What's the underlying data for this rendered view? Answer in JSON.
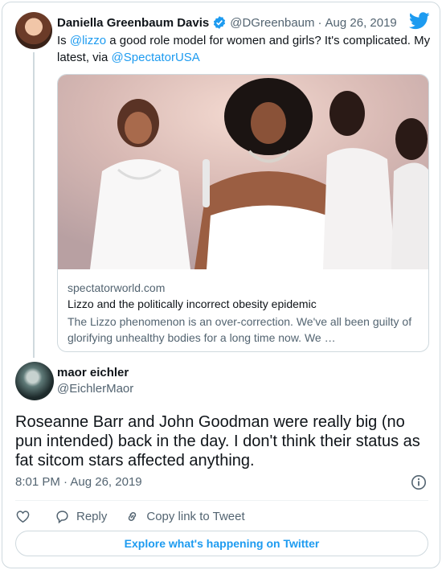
{
  "parent_tweet": {
    "author_name": "Daniella Greenbaum Davis",
    "author_handle": "@DGreenbaum",
    "separator": "·",
    "date": "Aug 26, 2019",
    "text_before": "Is ",
    "mention_1": "@lizzo",
    "text_middle": " a good role model for women and girls? It's complicated. My latest, via ",
    "mention_2": "@SpectatorUSA",
    "link_card": {
      "domain": "spectatorworld.com",
      "title": "Lizzo and the politically incorrect obesity epidemic",
      "description": "The Lizzo phenomenon is an over-correction. We've all been guilty of glorifying unhealthy bodies for a long time now. We …"
    }
  },
  "reply_tweet": {
    "author_name": "maor eichler",
    "author_handle": "@EichlerMaor",
    "text": "Roseanne Barr and John Goodman were really big (no pun intended) back in the day. I don't think their status as fat sitcom stars affected anything.",
    "time": "8:01 PM",
    "separator": "·",
    "date": "Aug 26, 2019"
  },
  "actions": {
    "reply_label": "Reply",
    "copy_link_label": "Copy link to Tweet"
  },
  "explore_label": "Explore what's happening on Twitter",
  "colors": {
    "accent": "#1d9bf0",
    "secondary_text": "#536471",
    "border": "#cfd9de"
  },
  "icons": [
    "verified-badge-icon",
    "twitter-bird-icon",
    "info-icon",
    "heart-icon",
    "reply-bubble-icon",
    "link-icon"
  ]
}
